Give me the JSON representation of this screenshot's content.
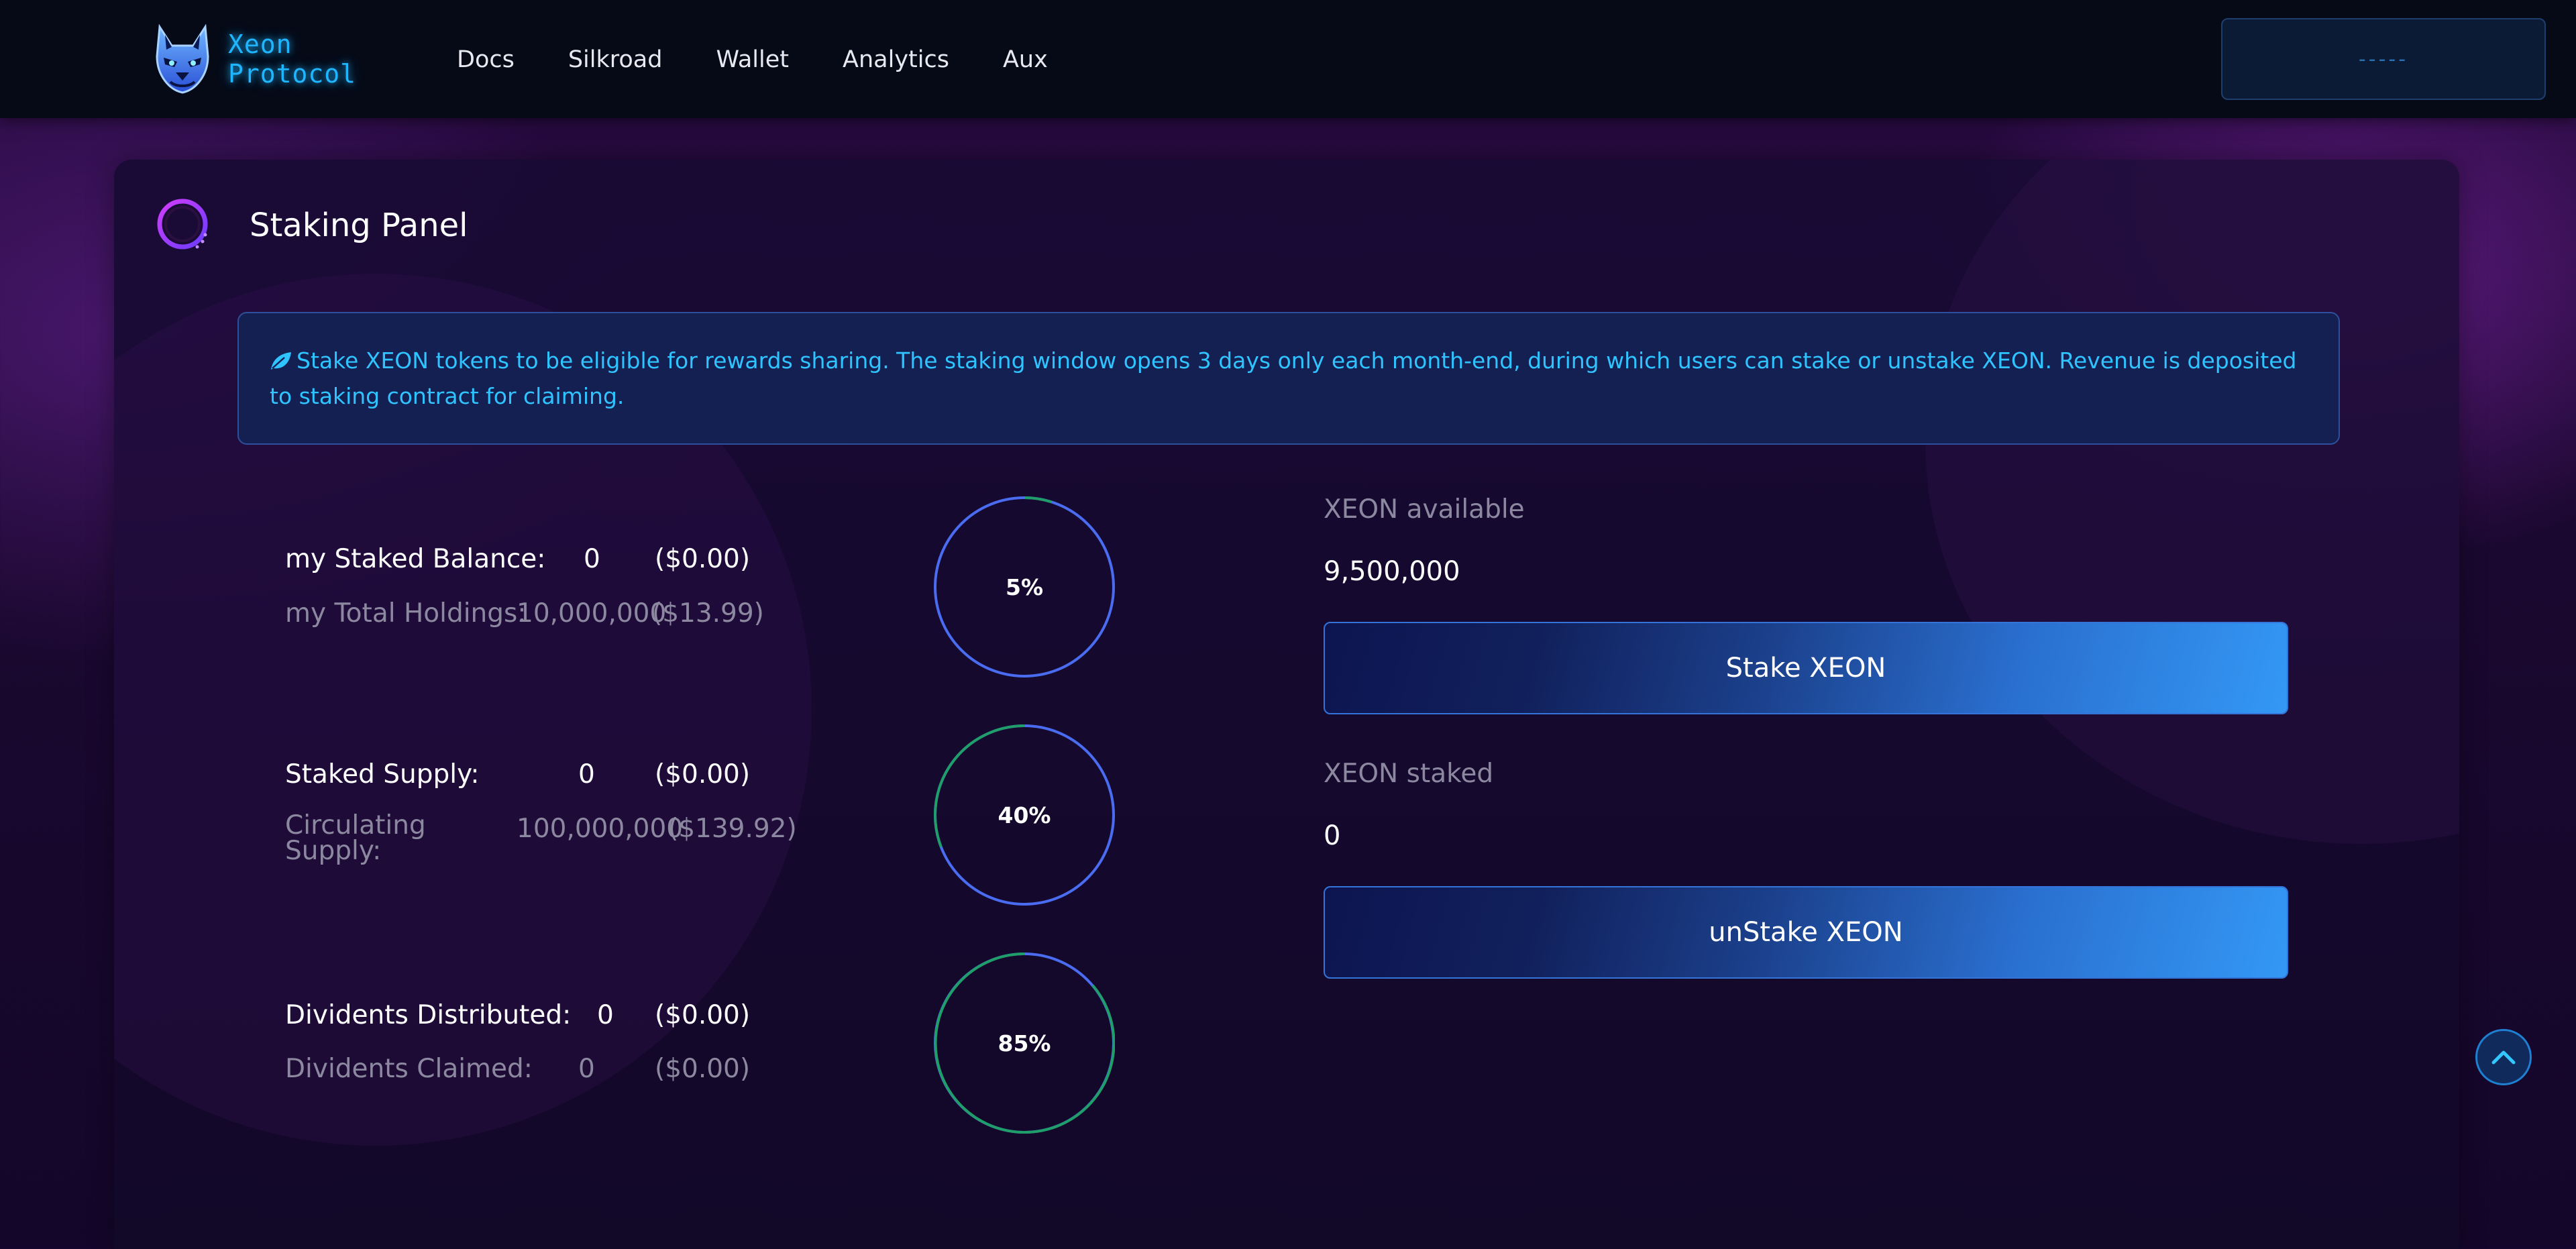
{
  "header": {
    "brand": {
      "line1": "Xeon",
      "line2": "Protocol"
    },
    "nav": [
      {
        "label": "Docs"
      },
      {
        "label": "Silkroad"
      },
      {
        "label": "Wallet"
      },
      {
        "label": "Analytics"
      },
      {
        "label": "Aux"
      }
    ],
    "wallet_button_label": "-----"
  },
  "panel": {
    "title": "Staking Panel",
    "info": "Stake XEON tokens to be eligible for rewards sharing. The staking window opens 3 days only each month-end, during which users can stake or unstake XEON. Revenue is deposited to staking contract for claiming.",
    "stats": {
      "staked_balance": {
        "label": "my Staked Balance:",
        "value": "0",
        "usd": "($0.00)"
      },
      "total_holdings": {
        "label": "my Total Holdings:",
        "value": "10,000,000",
        "usd": "($13.99)"
      },
      "staked_supply": {
        "label": "Staked Supply:",
        "value": "0",
        "usd": "($0.00)"
      },
      "circulating_supply": {
        "label_line1": "Circulating",
        "label_line2": "Supply:",
        "value": "100,000,000",
        "usd": "($139.92)"
      },
      "dividends_distributed": {
        "label": "Dividents Distributed:",
        "value": "0",
        "usd": "($0.00)"
      },
      "dividends_claimed": {
        "label": "Dividents Claimed:",
        "value": "0",
        "usd": "($0.00)"
      }
    },
    "circles": [
      {
        "label": "5%"
      },
      {
        "label": "40%"
      },
      {
        "label": "85%"
      }
    ],
    "available": {
      "label": "XEON available",
      "value": "9,500,000",
      "button": "Stake XEON"
    },
    "staked": {
      "label": "XEON staked",
      "value": "0",
      "button": "unStake XEON"
    }
  },
  "icons": {
    "brand": "wolf-logo-icon",
    "panel": "ring-icon",
    "info": "leaf-icon",
    "scroll": "chevron-up-icon"
  },
  "colors": {
    "header_bg": "#060a17",
    "accent": "#2fc3ff",
    "button_gradient_end": "#3498f5",
    "circle_green": "#1f9e6a",
    "circle_blue": "#4a6cf0"
  }
}
